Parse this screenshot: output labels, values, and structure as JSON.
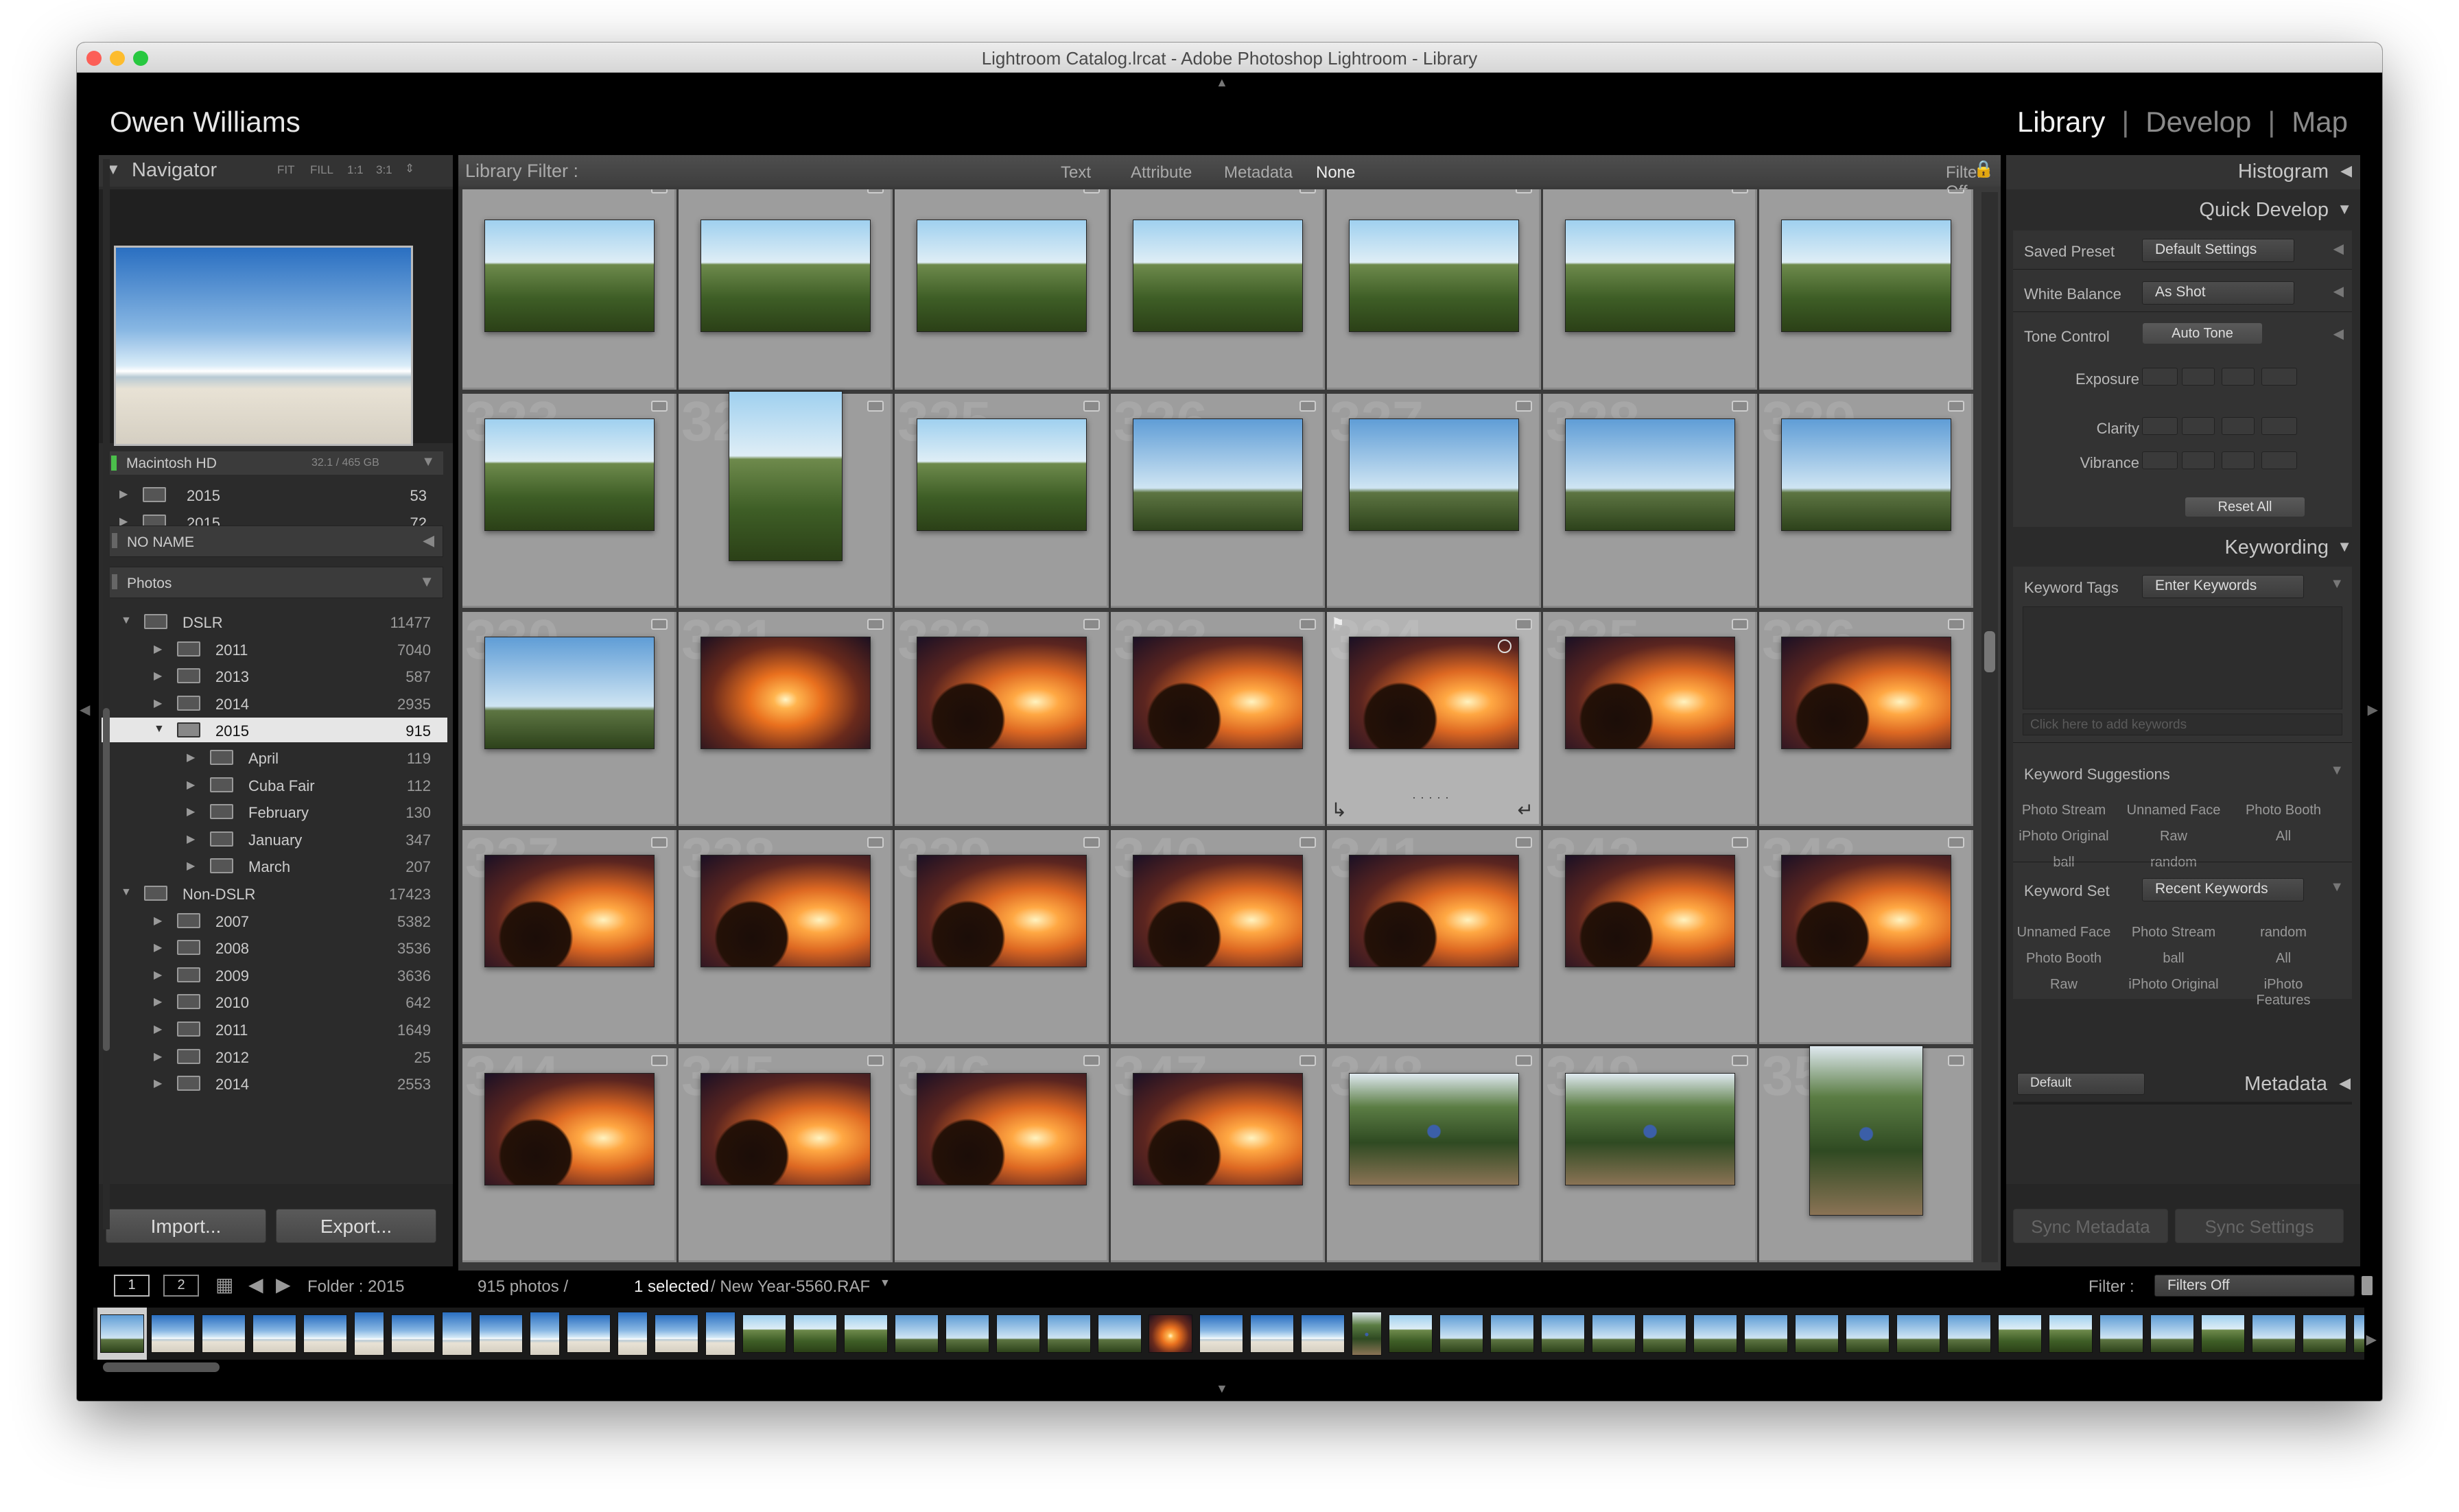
{
  "window": {
    "title": "Lightroom Catalog.lrcat - Adobe Photoshop Lightroom - Library"
  },
  "identity_plate": "Owen Williams",
  "modules": [
    {
      "label": "Library",
      "active": true
    },
    {
      "label": "Develop",
      "active": false
    },
    {
      "label": "Map",
      "active": false
    }
  ],
  "navigator": {
    "title": "Navigator",
    "zoom_options": [
      "FIT",
      "FILL",
      "1:1",
      "3:1"
    ]
  },
  "volume": {
    "name": "Macintosh HD",
    "capacity": "32.1 / 465 GB"
  },
  "folders_top": [
    {
      "name": "2015",
      "count": "53"
    },
    {
      "name": "2015",
      "count": "72"
    }
  ],
  "no_name_label": "NO NAME",
  "photos_label": "Photos",
  "tree": [
    {
      "name": "DSLR",
      "count": "11477",
      "level": 0,
      "expanded": true
    },
    {
      "name": "2011",
      "count": "7040",
      "level": 1
    },
    {
      "name": "2013",
      "count": "587",
      "level": 1
    },
    {
      "name": "2014",
      "count": "2935",
      "level": 1
    },
    {
      "name": "2015",
      "count": "915",
      "level": 1,
      "selected": true,
      "expanded": true
    },
    {
      "name": "April",
      "count": "119",
      "level": 2
    },
    {
      "name": "Cuba Fair",
      "count": "112",
      "level": 2
    },
    {
      "name": "February",
      "count": "130",
      "level": 2
    },
    {
      "name": "January",
      "count": "347",
      "level": 2
    },
    {
      "name": "March",
      "count": "207",
      "level": 2
    },
    {
      "name": "Non-DSLR",
      "count": "17423",
      "level": 0,
      "expanded": true
    },
    {
      "name": "2007",
      "count": "5382",
      "level": 1
    },
    {
      "name": "2008",
      "count": "3536",
      "level": 1
    },
    {
      "name": "2009",
      "count": "3636",
      "level": 1
    },
    {
      "name": "2010",
      "count": "642",
      "level": 1
    },
    {
      "name": "2011",
      "count": "1649",
      "level": 1
    },
    {
      "name": "2012",
      "count": "25",
      "level": 1
    },
    {
      "name": "2014",
      "count": "2553",
      "level": 1
    }
  ],
  "import_label": "Import...",
  "export_label": "Export...",
  "library_filter": {
    "label": "Library Filter :",
    "options": [
      "Text",
      "Attribute",
      "Metadata",
      "None"
    ],
    "active": "None",
    "filters_off": "Filters Off"
  },
  "grid": {
    "rows": [
      {
        "num": "",
        "types": [
          "corn",
          "corn",
          "corn",
          "selfie",
          "corn",
          "corn",
          "corn"
        ]
      },
      {
        "num": "323",
        "types": [
          "corn",
          "portrait",
          "corn",
          "sky",
          "sky",
          "sky",
          "sky"
        ]
      },
      {
        "num": "330",
        "types": [
          "sky",
          "sun",
          "dog",
          "dog",
          "dog",
          "dog",
          "dog"
        ]
      },
      {
        "num": "337",
        "types": [
          "dog",
          "dog",
          "dog",
          "dog",
          "dog",
          "dog",
          "dog"
        ]
      },
      {
        "num": "344",
        "types": [
          "dog",
          "dog",
          "dog",
          "dog",
          "forest",
          "forest",
          "forest-p"
        ]
      }
    ]
  },
  "right_panel": {
    "histogram": "Histogram",
    "quick_develop": "Quick Develop",
    "saved_preset_label": "Saved Preset",
    "saved_preset_value": "Default Settings",
    "white_balance_label": "White Balance",
    "white_balance_value": "As Shot",
    "tone_control_label": "Tone Control",
    "auto_tone": "Auto Tone",
    "exposure": "Exposure",
    "clarity": "Clarity",
    "vibrance": "Vibrance",
    "reset_all": "Reset All",
    "keywording": "Keywording",
    "keyword_tags_label": "Keyword Tags",
    "keyword_tags_value": "Enter Keywords",
    "keywords_placeholder": "Click here to add keywords",
    "keyword_suggestions": "Keyword Suggestions",
    "suggestions": [
      "Photo Stream",
      "Unnamed Face",
      "Photo Booth",
      "iPhoto Original",
      "Raw",
      "All",
      "ball",
      "random"
    ],
    "keyword_set_label": "Keyword Set",
    "keyword_set_value": "Recent Keywords",
    "keyword_set": [
      "Unnamed Face",
      "Photo Stream",
      "random",
      "Photo Booth",
      "ball",
      "All",
      "Raw",
      "iPhoto Original",
      "iPhoto Features"
    ],
    "metadata_default": "Default",
    "metadata": "Metadata",
    "sync_metadata": "Sync Metadata",
    "sync_settings": "Sync Settings"
  },
  "status": {
    "screen1": "1",
    "screen2": "2",
    "folder": "Folder : 2015",
    "photos_count": "915 photos /",
    "selected": "1 selected",
    "file": "/ New Year-5560.RAF",
    "filter_label": "Filter :",
    "filter_value": "Filters Off"
  },
  "colors": {
    "window_bg": "#000000",
    "panel_bg": "#2b2b2b",
    "grid_bg": "#9d9d9d",
    "selected_row": "#e6e6e6"
  }
}
